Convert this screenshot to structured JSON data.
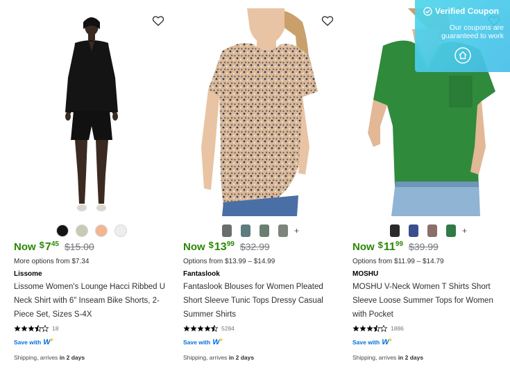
{
  "products": [
    {
      "price_prefix": "Now",
      "price_symbol": "$",
      "price_whole": "7",
      "price_cents": "45",
      "was_price": "$15.00",
      "options": "More options from $7.34",
      "brand": "Lissome",
      "title": "Lissome Women's Lounge Hacci Ribbed U Neck Shirt with 6\" Inseam Bike Shorts, 2-Piece Set, Sizes S-4X",
      "rating": 3.5,
      "review_count": "18",
      "save_with_label": "Save with",
      "shipping_prefix": "Shipping, arrives",
      "shipping_days": "in 2 days",
      "swatches": [
        "#141414",
        "#c6cbb4",
        "#f2b693",
        "#eeeeee"
      ]
    },
    {
      "price_prefix": "Now",
      "price_symbol": "$",
      "price_whole": "13",
      "price_cents": "99",
      "was_price": "$32.99",
      "options": "Options from $13.99 – $14.99",
      "brand": "Fantaslook",
      "title": "Fantaslook Blouses for Women Pleated Short Sleeve Tunic Tops Dressy Casual Summer Shirts",
      "rating": 4.5,
      "review_count": "5284",
      "save_with_label": "Save with",
      "shipping_prefix": "Shipping, arrives",
      "shipping_days": "in 2 days",
      "swatches": [
        "#6a6e6a",
        "#5f7b7e",
        "#6b7f70",
        "#7c857c"
      ],
      "more_symbol": "+"
    },
    {
      "price_prefix": "Now",
      "price_symbol": "$",
      "price_whole": "11",
      "price_cents": "99",
      "was_price": "$39.99",
      "options": "Options from $11.99 – $14.79",
      "brand": "MOSHU",
      "title": "MOSHU V-Neck Women T Shirts Short Sleeve Loose Summer Tops for Women with Pocket",
      "rating": 3.5,
      "review_count": "1886",
      "save_with_label": "Save with",
      "shipping_prefix": "Shipping, arrives",
      "shipping_days": "in 2 days",
      "swatches": [
        "#2a2a2a",
        "#3a4f8f",
        "#8c6f6a",
        "#2f7a45"
      ],
      "more_symbol": "+"
    }
  ],
  "coupon": {
    "title": "Verified Coupon",
    "subtitle": "Our coupons are guaranteed to work"
  },
  "colors": {
    "price_green": "#2a8703",
    "walmart_blue": "#0071dc",
    "walmart_yellow": "#ffc220",
    "coupon_cyan": "#4ed6ec"
  },
  "icons": [
    "heart-outline-icon",
    "star-icon",
    "walmart-plus-icon",
    "check-circle-icon",
    "home-icon"
  ]
}
